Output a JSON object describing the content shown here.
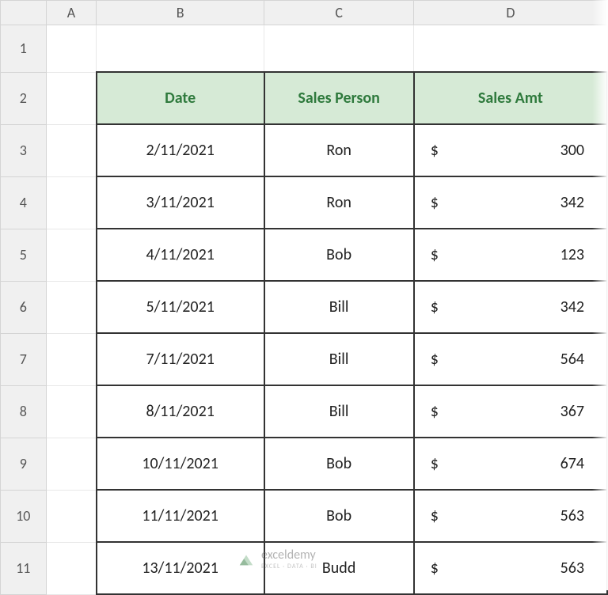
{
  "columns": [
    "A",
    "B",
    "C",
    "D"
  ],
  "rowNumbers": [
    "1",
    "2",
    "3",
    "4",
    "5",
    "6",
    "7",
    "8",
    "9",
    "10",
    "11"
  ],
  "headers": {
    "date": "Date",
    "person": "Sales Person",
    "amount": "Sales Amt"
  },
  "currencySymbol": "$",
  "rows": [
    {
      "date": "2/11/2021",
      "person": "Ron",
      "amount": "300"
    },
    {
      "date": "3/11/2021",
      "person": "Ron",
      "amount": "342"
    },
    {
      "date": "4/11/2021",
      "person": "Bob",
      "amount": "123"
    },
    {
      "date": "5/11/2021",
      "person": "Bill",
      "amount": "342"
    },
    {
      "date": "7/11/2021",
      "person": "Bill",
      "amount": "564"
    },
    {
      "date": "8/11/2021",
      "person": "Bill",
      "amount": "367"
    },
    {
      "date": "10/11/2021",
      "person": "Bob",
      "amount": "674"
    },
    {
      "date": "11/11/2021",
      "person": "Bob",
      "amount": "563"
    },
    {
      "date": "13/11/2021",
      "person": "Budd",
      "amount": "563"
    }
  ],
  "watermark": {
    "brand": "exceldemy",
    "tagline": "EXCEL · DATA · BI"
  }
}
